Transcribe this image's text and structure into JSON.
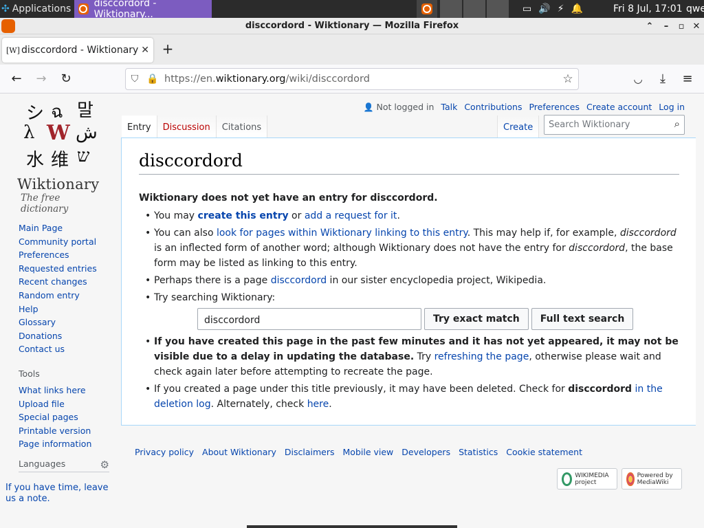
{
  "taskbar": {
    "apps_label": "Applications",
    "active_task": "disccordord - Wiktionary...",
    "clock": "Fri  8 Jul, 17:01",
    "user": "qwe"
  },
  "window": {
    "title": "disccordord - Wiktionary — Mozilla Firefox"
  },
  "browser": {
    "tab_title": "disccordord - Wiktionary",
    "tab_favicon": "[W]",
    "url_prefix": "https://en.",
    "url_domain": "wiktionary.org",
    "url_path": "/wiki/disccordord"
  },
  "site": {
    "name": "Wiktionary",
    "tagline": "The free dictionary"
  },
  "sidebar": {
    "nav": [
      "Main Page",
      "Community portal",
      "Preferences",
      "Requested entries",
      "Recent changes",
      "Random entry",
      "Help",
      "Glossary",
      "Donations",
      "Contact us"
    ],
    "tools_heading": "Tools",
    "tools": [
      "What links here",
      "Upload file",
      "Special pages",
      "Printable version",
      "Page information"
    ],
    "languages_heading": "Languages",
    "languages_note": "If you have time, leave us a note."
  },
  "userlinks": {
    "not_logged_in": "Not logged in",
    "talk": "Talk",
    "contributions": "Contributions",
    "preferences": "Preferences",
    "create_account": "Create account",
    "login": "Log in"
  },
  "tabs": {
    "entry": "Entry",
    "discussion": "Discussion",
    "citations": "Citations",
    "create": "Create"
  },
  "search": {
    "placeholder": "Search Wiktionary"
  },
  "article": {
    "title": "disccordord",
    "lead": "Wiktionary does not yet have an entry for disccordord.",
    "b1_pre": "You may ",
    "b1_link1": "create this entry",
    "b1_mid": " or ",
    "b1_link2": "add a request for it",
    "b1_post": ".",
    "b2_pre": "You can also ",
    "b2_link": "look for pages within Wiktionary linking to this entry",
    "b2_t1": ". This may help if, for example, ",
    "b2_i1": "disccordord",
    "b2_t2": " is an inflected form of another word; although Wiktionary does not have the entry for ",
    "b2_i2": "disccordord",
    "b2_t3": ", the base form may be listed as linking to this entry.",
    "b3_pre": "Perhaps there is a page ",
    "b3_link": "disccordord",
    "b3_post": " in our sister encyclopedia project, Wikipedia.",
    "b4": "Try searching Wiktionary:",
    "search_value": "disccordord",
    "btn_exact": "Try exact match",
    "btn_full": "Full text search",
    "b5_bold": "If you have created this page in the past few minutes and it has not yet appeared, it may not be visible due to a delay in updating the database.",
    "b5_t1": " Try ",
    "b5_link": "refreshing the page",
    "b5_t2": ", otherwise please wait and check again later before attempting to recreate the page.",
    "b6_t1": "If you created a page under this title previously, it may have been deleted. Check for ",
    "b6_bold": "disccordord",
    "b6_link1": " in the deletion log",
    "b6_t2": ". Alternately, check ",
    "b6_link2": "here",
    "b6_t3": "."
  },
  "footer": {
    "links": [
      "Privacy policy",
      "About Wiktionary",
      "Disclaimers",
      "Mobile view",
      "Developers",
      "Statistics",
      "Cookie statement"
    ],
    "wikimedia_label": "WIKIMEDIA project",
    "mediawiki_label": "Powered by MediaWiki"
  },
  "colors": {
    "link": "#0645ad",
    "new_link": "#ba0000",
    "border": "#a7d7f9",
    "taskbar_active": "#7c5cc0",
    "firefox_orange": "#e66000"
  }
}
